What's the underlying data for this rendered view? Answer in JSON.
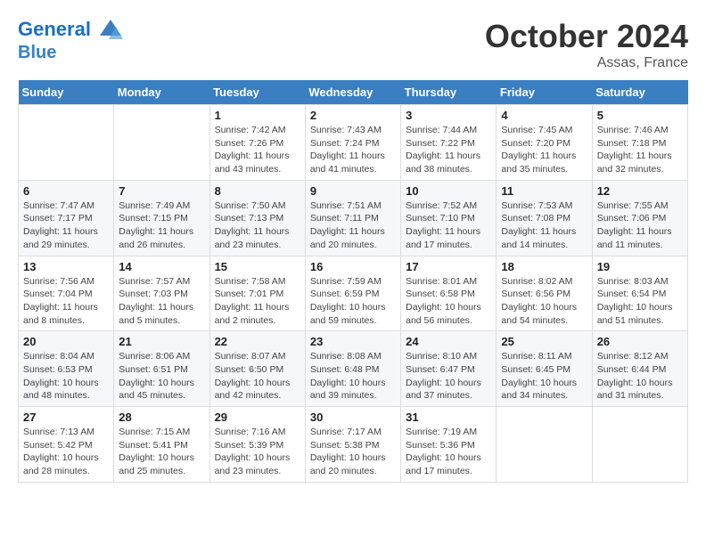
{
  "header": {
    "logo_line1": "General",
    "logo_line2": "Blue",
    "month": "October 2024",
    "location": "Assas, France"
  },
  "weekdays": [
    "Sunday",
    "Monday",
    "Tuesday",
    "Wednesday",
    "Thursday",
    "Friday",
    "Saturday"
  ],
  "weeks": [
    [
      {
        "day": "",
        "info": ""
      },
      {
        "day": "",
        "info": ""
      },
      {
        "day": "1",
        "info": "Sunrise: 7:42 AM\nSunset: 7:26 PM\nDaylight: 11 hours and 43 minutes."
      },
      {
        "day": "2",
        "info": "Sunrise: 7:43 AM\nSunset: 7:24 PM\nDaylight: 11 hours and 41 minutes."
      },
      {
        "day": "3",
        "info": "Sunrise: 7:44 AM\nSunset: 7:22 PM\nDaylight: 11 hours and 38 minutes."
      },
      {
        "day": "4",
        "info": "Sunrise: 7:45 AM\nSunset: 7:20 PM\nDaylight: 11 hours and 35 minutes."
      },
      {
        "day": "5",
        "info": "Sunrise: 7:46 AM\nSunset: 7:18 PM\nDaylight: 11 hours and 32 minutes."
      }
    ],
    [
      {
        "day": "6",
        "info": "Sunrise: 7:47 AM\nSunset: 7:17 PM\nDaylight: 11 hours and 29 minutes."
      },
      {
        "day": "7",
        "info": "Sunrise: 7:49 AM\nSunset: 7:15 PM\nDaylight: 11 hours and 26 minutes."
      },
      {
        "day": "8",
        "info": "Sunrise: 7:50 AM\nSunset: 7:13 PM\nDaylight: 11 hours and 23 minutes."
      },
      {
        "day": "9",
        "info": "Sunrise: 7:51 AM\nSunset: 7:11 PM\nDaylight: 11 hours and 20 minutes."
      },
      {
        "day": "10",
        "info": "Sunrise: 7:52 AM\nSunset: 7:10 PM\nDaylight: 11 hours and 17 minutes."
      },
      {
        "day": "11",
        "info": "Sunrise: 7:53 AM\nSunset: 7:08 PM\nDaylight: 11 hours and 14 minutes."
      },
      {
        "day": "12",
        "info": "Sunrise: 7:55 AM\nSunset: 7:06 PM\nDaylight: 11 hours and 11 minutes."
      }
    ],
    [
      {
        "day": "13",
        "info": "Sunrise: 7:56 AM\nSunset: 7:04 PM\nDaylight: 11 hours and 8 minutes."
      },
      {
        "day": "14",
        "info": "Sunrise: 7:57 AM\nSunset: 7:03 PM\nDaylight: 11 hours and 5 minutes."
      },
      {
        "day": "15",
        "info": "Sunrise: 7:58 AM\nSunset: 7:01 PM\nDaylight: 11 hours and 2 minutes."
      },
      {
        "day": "16",
        "info": "Sunrise: 7:59 AM\nSunset: 6:59 PM\nDaylight: 10 hours and 59 minutes."
      },
      {
        "day": "17",
        "info": "Sunrise: 8:01 AM\nSunset: 6:58 PM\nDaylight: 10 hours and 56 minutes."
      },
      {
        "day": "18",
        "info": "Sunrise: 8:02 AM\nSunset: 6:56 PM\nDaylight: 10 hours and 54 minutes."
      },
      {
        "day": "19",
        "info": "Sunrise: 8:03 AM\nSunset: 6:54 PM\nDaylight: 10 hours and 51 minutes."
      }
    ],
    [
      {
        "day": "20",
        "info": "Sunrise: 8:04 AM\nSunset: 6:53 PM\nDaylight: 10 hours and 48 minutes."
      },
      {
        "day": "21",
        "info": "Sunrise: 8:06 AM\nSunset: 6:51 PM\nDaylight: 10 hours and 45 minutes."
      },
      {
        "day": "22",
        "info": "Sunrise: 8:07 AM\nSunset: 6:50 PM\nDaylight: 10 hours and 42 minutes."
      },
      {
        "day": "23",
        "info": "Sunrise: 8:08 AM\nSunset: 6:48 PM\nDaylight: 10 hours and 39 minutes."
      },
      {
        "day": "24",
        "info": "Sunrise: 8:10 AM\nSunset: 6:47 PM\nDaylight: 10 hours and 37 minutes."
      },
      {
        "day": "25",
        "info": "Sunrise: 8:11 AM\nSunset: 6:45 PM\nDaylight: 10 hours and 34 minutes."
      },
      {
        "day": "26",
        "info": "Sunrise: 8:12 AM\nSunset: 6:44 PM\nDaylight: 10 hours and 31 minutes."
      }
    ],
    [
      {
        "day": "27",
        "info": "Sunrise: 7:13 AM\nSunset: 5:42 PM\nDaylight: 10 hours and 28 minutes."
      },
      {
        "day": "28",
        "info": "Sunrise: 7:15 AM\nSunset: 5:41 PM\nDaylight: 10 hours and 25 minutes."
      },
      {
        "day": "29",
        "info": "Sunrise: 7:16 AM\nSunset: 5:39 PM\nDaylight: 10 hours and 23 minutes."
      },
      {
        "day": "30",
        "info": "Sunrise: 7:17 AM\nSunset: 5:38 PM\nDaylight: 10 hours and 20 minutes."
      },
      {
        "day": "31",
        "info": "Sunrise: 7:19 AM\nSunset: 5:36 PM\nDaylight: 10 hours and 17 minutes."
      },
      {
        "day": "",
        "info": ""
      },
      {
        "day": "",
        "info": ""
      }
    ]
  ]
}
